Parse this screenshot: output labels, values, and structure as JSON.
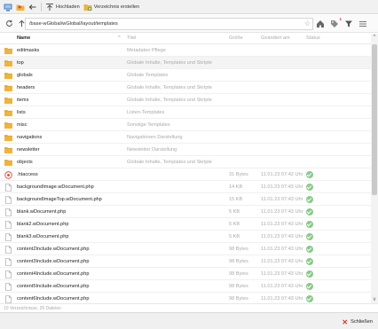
{
  "toolbar": {
    "upload_label": "Hochladen",
    "mkdir_label": "Verzeichnis erstellen"
  },
  "address": {
    "path": "/base-wGlobal/wGlobal/layout/templates",
    "notification_count": "1"
  },
  "columns": {
    "name": "Name",
    "title": "Titel",
    "size": "Größe",
    "modified": "Geändert am",
    "status": "Status"
  },
  "rows": [
    {
      "type": "folder",
      "name": "editmasks",
      "title": "Metadaten Pflege",
      "size": "",
      "modified": "",
      "status": false
    },
    {
      "type": "folder",
      "name": "top",
      "title": "Globale Inhalte, Templates und Skripte",
      "size": "",
      "modified": "",
      "status": false,
      "highlight": true
    },
    {
      "type": "folder",
      "name": "globals",
      "title": "Globale Templates",
      "size": "",
      "modified": "",
      "status": false
    },
    {
      "type": "folder",
      "name": "headers",
      "title": "Globale Inhalte, Templates und Skripte",
      "size": "",
      "modified": "",
      "status": false
    },
    {
      "type": "folder",
      "name": "items",
      "title": "Globale Inhalte, Templates und Skripte",
      "size": "",
      "modified": "",
      "status": false
    },
    {
      "type": "folder",
      "name": "lists",
      "title": "Listen-Templates",
      "size": "",
      "modified": "",
      "status": false
    },
    {
      "type": "folder",
      "name": "misc",
      "title": "Sonstige Templates",
      "size": "",
      "modified": "",
      "status": false
    },
    {
      "type": "folder",
      "name": "navigations",
      "title": "Navigationen Darstellung",
      "size": "",
      "modified": "",
      "status": false
    },
    {
      "type": "folder",
      "name": "newsletter",
      "title": "Newsletter Darstellung",
      "size": "",
      "modified": "",
      "status": false
    },
    {
      "type": "folder",
      "name": "objects",
      "title": "Globale Inhalte, Templates und Skripte",
      "size": "",
      "modified": "",
      "status": false
    },
    {
      "type": "special",
      "name": ".htaccess",
      "title": "",
      "size": "31 Bytes",
      "modified": "11.01.23 07:42 Uhr",
      "status": true
    },
    {
      "type": "file",
      "name": "backgroundImage.wDocument.php",
      "title": "",
      "size": "14 KB",
      "modified": "11.01.23 07:43 Uhr",
      "status": true
    },
    {
      "type": "file",
      "name": "backgroundImageTop.wDocument.php",
      "title": "",
      "size": "15 KB",
      "modified": "11.01.23 07:43 Uhr",
      "status": true
    },
    {
      "type": "file",
      "name": "blank.wDocument.php",
      "title": "",
      "size": "5 KB",
      "modified": "11.01.23 07:43 Uhr",
      "status": true
    },
    {
      "type": "file",
      "name": "blank2.wDocument.php",
      "title": "",
      "size": "5 KB",
      "modified": "11.01.23 07:43 Uhr",
      "status": true
    },
    {
      "type": "file",
      "name": "blank3.wDocument.php",
      "title": "",
      "size": "5 KB",
      "modified": "11.01.23 07:43 Uhr",
      "status": true
    },
    {
      "type": "file",
      "name": "content2Include.wDocument.php",
      "title": "",
      "size": "98 Bytes",
      "modified": "11.01.23 07:43 Uhr",
      "status": true
    },
    {
      "type": "file",
      "name": "content3Include.wDocument.php",
      "title": "",
      "size": "98 Bytes",
      "modified": "11.01.23 07:43 Uhr",
      "status": true
    },
    {
      "type": "file",
      "name": "content4Include.wDocument.php",
      "title": "",
      "size": "98 Bytes",
      "modified": "11.01.23 07:43 Uhr",
      "status": true
    },
    {
      "type": "file",
      "name": "content5Include.wDocument.php",
      "title": "",
      "size": "98 Bytes",
      "modified": "11.01.23 07:43 Uhr",
      "status": true
    },
    {
      "type": "file",
      "name": "content6Include.wDocument.php",
      "title": "",
      "size": "98 Bytes",
      "modified": "11.01.23 07:43 Uhr",
      "status": true
    }
  ],
  "statusbar": {
    "summary": "10 Verzeichnisse, 26 Dateien"
  },
  "footer": {
    "close_label": "Schließen"
  },
  "colors": {
    "folder": "#f0b43c",
    "accent": "#d23a2e",
    "status_ok": "#8ac98a"
  }
}
